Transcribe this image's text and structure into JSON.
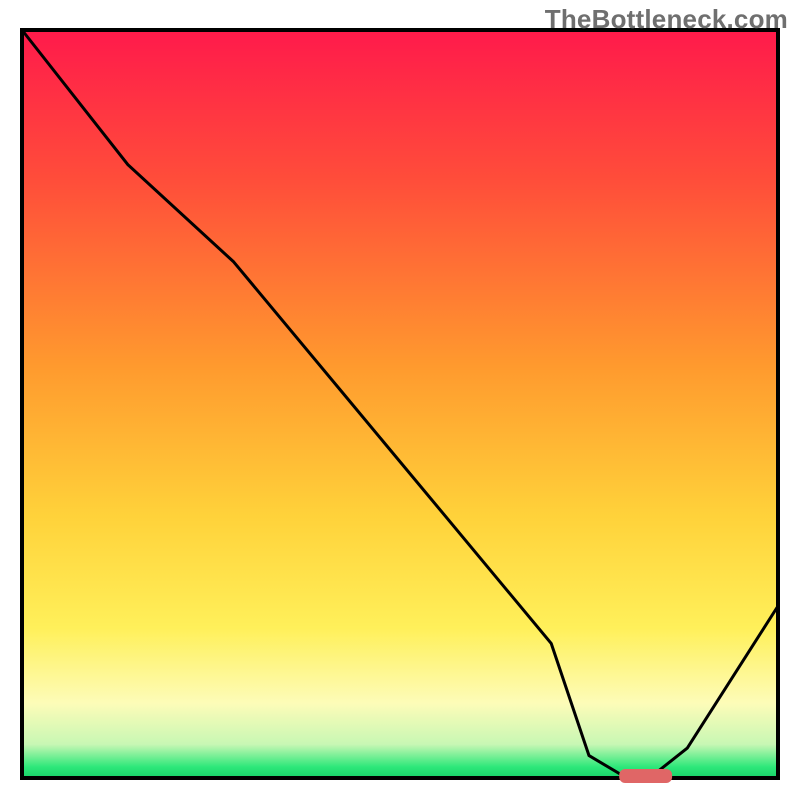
{
  "watermark": "TheBottleneck.com",
  "chart_data": {
    "type": "line",
    "title": "",
    "xlabel": "",
    "ylabel": "",
    "xlim": [
      0,
      100
    ],
    "ylim": [
      0,
      100
    ],
    "series": [
      {
        "name": "bottleneck-curve",
        "x": [
          0,
          14,
          28,
          42,
          56,
          70,
          75,
          80,
          83,
          88,
          100
        ],
        "y": [
          100,
          82,
          69,
          52,
          35,
          18,
          3,
          0,
          0,
          4,
          23
        ]
      }
    ],
    "marker": {
      "name": "optimal-range",
      "x_start": 79,
      "x_end": 86,
      "y": 0,
      "color": "#e06666"
    },
    "gradient_stops": [
      {
        "offset": 0.0,
        "color": "#ff1a4b"
      },
      {
        "offset": 0.2,
        "color": "#ff4d3a"
      },
      {
        "offset": 0.45,
        "color": "#ff9a2e"
      },
      {
        "offset": 0.65,
        "color": "#ffd23a"
      },
      {
        "offset": 0.8,
        "color": "#fff05a"
      },
      {
        "offset": 0.9,
        "color": "#fdfcb8"
      },
      {
        "offset": 0.955,
        "color": "#c8f7b4"
      },
      {
        "offset": 0.985,
        "color": "#2ee87a"
      },
      {
        "offset": 1.0,
        "color": "#17d268"
      }
    ],
    "border_color": "#000000",
    "line_color": "#000000"
  }
}
